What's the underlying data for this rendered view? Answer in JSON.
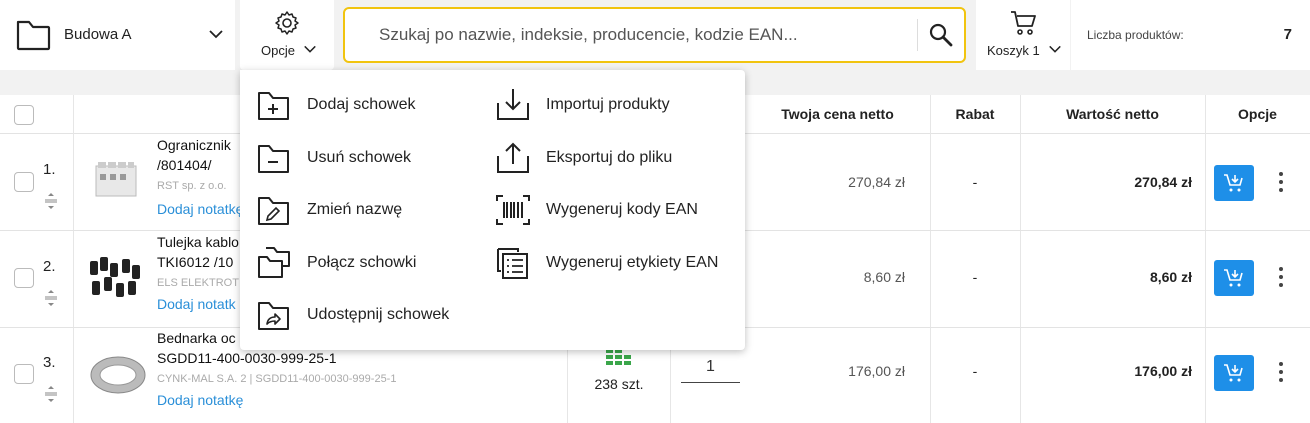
{
  "topbar": {
    "folder_label": "Budowa A",
    "options_label": "Opcje",
    "search_placeholder": "Szukaj po nazwie, indeksie, producencie, kodzie EAN...",
    "cart_label": "Koszyk 1",
    "count_label": "Liczba produktów:",
    "count_value": "7"
  },
  "table": {
    "headers": {
      "price": "Twoja cena netto",
      "discount": "Rabat",
      "value": "Wartość netto",
      "options": "Opcje"
    },
    "rows": [
      {
        "num": "1.",
        "name1": "Ogranicznik",
        "name2": "/801404/",
        "meta": "RST sp. z o.o.",
        "note": "Dodaj notatkę",
        "price": "270,84 zł",
        "discount": "-",
        "value": "270,84 zł"
      },
      {
        "num": "2.",
        "name1": "Tulejka kablo",
        "name2": "TKI6012 /10",
        "meta": "ELS ELEKTROT",
        "note": "Dodaj notatk",
        "price": "8,60 zł",
        "discount": "-",
        "value": "8,60 zł"
      },
      {
        "num": "3.",
        "name1": "Bednarka oc",
        "name2": "SGDD11-400-0030-999-25-1",
        "meta": "CYNK-MAL S.A. 2 | SGDD11-400-0030-999-25-1",
        "note": "Dodaj notatkę",
        "stock": "238 szt.",
        "qty": "1",
        "price": "176,00 zł",
        "discount": "-",
        "value": "176,00 zł"
      }
    ]
  },
  "menu": {
    "left": [
      {
        "label": "Dodaj schowek",
        "icon": "folder-plus-icon"
      },
      {
        "label": "Usuń schowek",
        "icon": "folder-minus-icon"
      },
      {
        "label": "Zmień nazwę",
        "icon": "folder-edit-icon"
      },
      {
        "label": "Połącz schowki",
        "icon": "folders-merge-icon"
      },
      {
        "label": "Udostępnij schowek",
        "icon": "folder-share-icon"
      }
    ],
    "right": [
      {
        "label": "Importuj produkty",
        "icon": "import-icon"
      },
      {
        "label": "Eksportuj do pliku",
        "icon": "export-icon"
      },
      {
        "label": "Wygeneruj kody EAN",
        "icon": "barcode-icon"
      },
      {
        "label": "Wygeneruj etykiety EAN",
        "icon": "label-list-icon"
      }
    ]
  },
  "colors": {
    "accent_blue": "#1e8fe8",
    "search_border": "#f1c40f",
    "link_blue": "#2a8fd8",
    "stock_green": "#3aa64a"
  }
}
